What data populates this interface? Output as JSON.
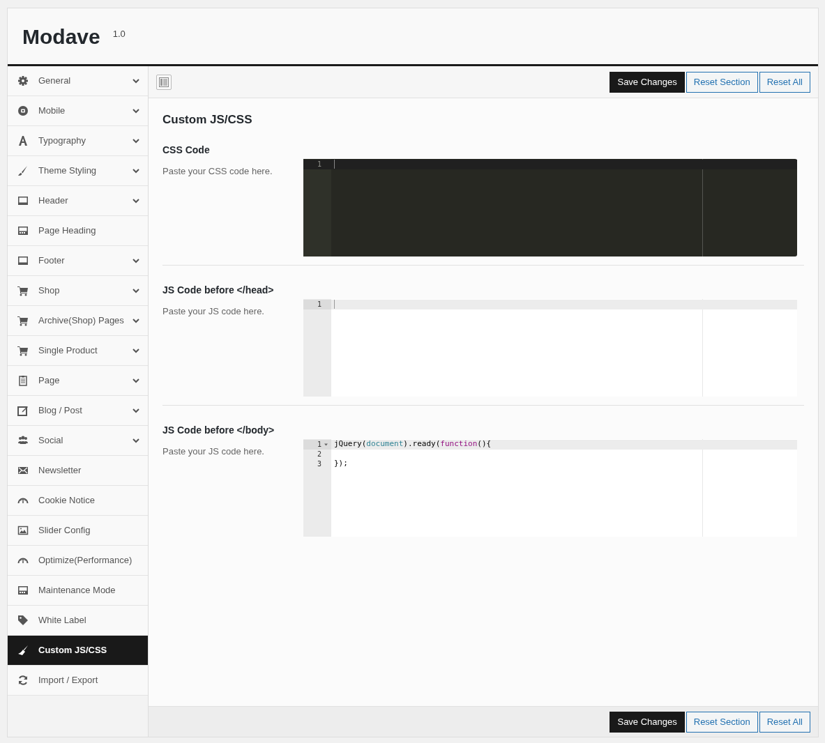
{
  "header": {
    "title": "Modave",
    "version": "1.0"
  },
  "sidebar": {
    "items": [
      {
        "label": "General",
        "has_submenu": true,
        "selected": false
      },
      {
        "label": "Mobile",
        "has_submenu": true,
        "selected": false
      },
      {
        "label": "Typography",
        "has_submenu": true,
        "selected": false
      },
      {
        "label": "Theme Styling",
        "has_submenu": true,
        "selected": false
      },
      {
        "label": "Header",
        "has_submenu": true,
        "selected": false
      },
      {
        "label": "Page Heading",
        "has_submenu": false,
        "selected": false
      },
      {
        "label": "Footer",
        "has_submenu": true,
        "selected": false
      },
      {
        "label": "Shop",
        "has_submenu": true,
        "selected": false
      },
      {
        "label": "Archive(Shop) Pages",
        "has_submenu": true,
        "selected": false
      },
      {
        "label": "Single Product",
        "has_submenu": true,
        "selected": false
      },
      {
        "label": "Page",
        "has_submenu": true,
        "selected": false
      },
      {
        "label": "Blog / Post",
        "has_submenu": true,
        "selected": false
      },
      {
        "label": "Social",
        "has_submenu": true,
        "selected": false
      },
      {
        "label": "Newsletter",
        "has_submenu": false,
        "selected": false
      },
      {
        "label": "Cookie Notice",
        "has_submenu": false,
        "selected": false
      },
      {
        "label": "Slider Config",
        "has_submenu": false,
        "selected": false
      },
      {
        "label": "Optimize(Performance)",
        "has_submenu": false,
        "selected": false
      },
      {
        "label": "Maintenance Mode",
        "has_submenu": false,
        "selected": false
      },
      {
        "label": "White Label",
        "has_submenu": false,
        "selected": false
      },
      {
        "label": "Custom JS/CSS",
        "has_submenu": false,
        "selected": true
      },
      {
        "label": "Import / Export",
        "has_submenu": false,
        "selected": false
      }
    ]
  },
  "toolbar": {
    "buttons": [
      {
        "label": "Save Changes",
        "kind": "primary"
      },
      {
        "label": "Reset Section",
        "kind": "secondary"
      },
      {
        "label": "Reset All",
        "kind": "secondary"
      }
    ]
  },
  "section": {
    "title": "Custom JS/CSS",
    "fields": [
      {
        "label": "CSS Code",
        "description": "Paste your CSS code here.",
        "kind": "dark",
        "lines": [
          {
            "number": "1",
            "foldable": false
          }
        ]
      },
      {
        "label": "JS Code before </head>",
        "description": "Paste your JS code here.",
        "kind": "light",
        "lines": [
          {
            "number": "1",
            "foldable": false
          }
        ]
      },
      {
        "label": "JS Code before </body>",
        "description": "Paste your JS code here.",
        "kind": "light",
        "lines": [
          {
            "number": "1",
            "foldable": true,
            "tokens": [
              {
                "text": "jQuery(",
                "kind": "plain"
              },
              {
                "text": "document",
                "kind": "variable"
              },
              {
                "text": ").ready(",
                "kind": "plain"
              },
              {
                "text": "function",
                "kind": "keyword"
              },
              {
                "text": "(){",
                "kind": "plain"
              }
            ]
          },
          {
            "number": "2",
            "foldable": false
          },
          {
            "number": "3",
            "foldable": false,
            "tokens": [
              {
                "text": "});",
                "kind": "plain"
              }
            ]
          }
        ]
      }
    ]
  },
  "footer": {
    "buttons": [
      {
        "label": "Save Changes",
        "kind": "primary"
      },
      {
        "label": "Reset Section",
        "kind": "secondary"
      },
      {
        "label": "Reset All",
        "kind": "secondary"
      }
    ]
  }
}
